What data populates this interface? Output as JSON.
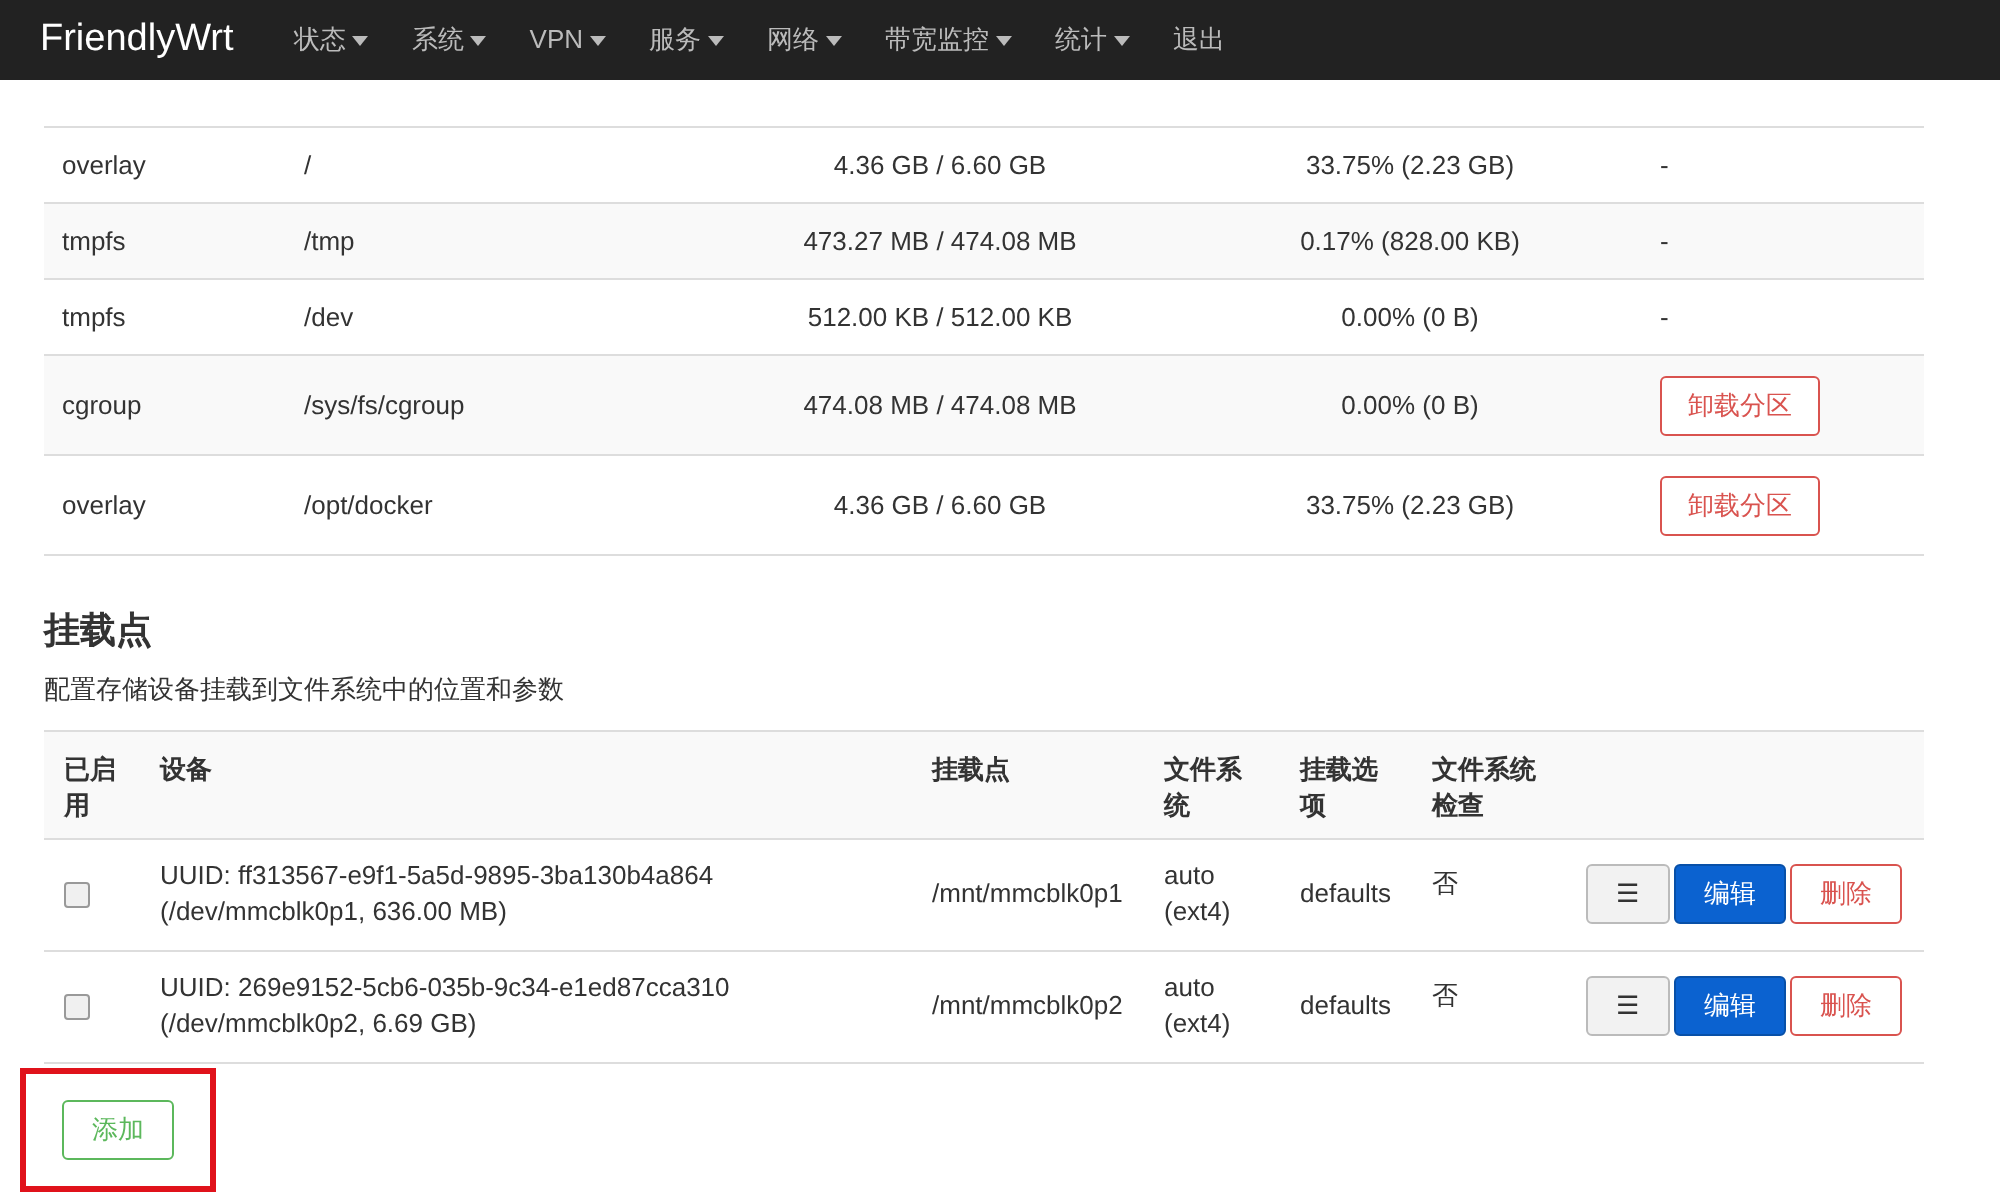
{
  "navbar": {
    "brand": "FriendlyWrt",
    "menu": [
      {
        "label": "状态",
        "dropdown": true
      },
      {
        "label": "系统",
        "dropdown": true
      },
      {
        "label": "VPN",
        "dropdown": true
      },
      {
        "label": "服务",
        "dropdown": true
      },
      {
        "label": "网络",
        "dropdown": true
      },
      {
        "label": "带宽监控",
        "dropdown": true
      },
      {
        "label": "统计",
        "dropdown": true
      },
      {
        "label": "退出",
        "dropdown": false
      }
    ]
  },
  "mounted_table": {
    "rows": [
      {
        "filesystem": "overlay",
        "mount": "/",
        "size": "4.36 GB / 6.60 GB",
        "usage": "33.75% (2.23 GB)",
        "action": "-"
      },
      {
        "filesystem": "tmpfs",
        "mount": "/tmp",
        "size": "473.27 MB / 474.08 MB",
        "usage": "0.17% (828.00 KB)",
        "action": "-"
      },
      {
        "filesystem": "tmpfs",
        "mount": "/dev",
        "size": "512.00 KB / 512.00 KB",
        "usage": "0.00% (0 B)",
        "action": "-"
      },
      {
        "filesystem": "cgroup",
        "mount": "/sys/fs/cgroup",
        "size": "474.08 MB / 474.08 MB",
        "usage": "0.00% (0 B)",
        "unmount_button": "卸载分区"
      },
      {
        "filesystem": "overlay",
        "mount": "/opt/docker",
        "size": "4.36 GB / 6.60 GB",
        "usage": "33.75% (2.23 GB)",
        "unmount_button": "卸载分区"
      }
    ]
  },
  "mount_points": {
    "title": "挂载点",
    "description": "配置存储设备挂载到文件系统中的位置和参数",
    "columns": [
      "已启用",
      "设备",
      "挂载点",
      "文件系统",
      "挂载选项",
      "文件系统检查"
    ],
    "rows": [
      {
        "enabled": false,
        "device": "UUID: ff313567-e9f1-5a5d-9895-3ba130b4a864",
        "device_detail": "(/dev/mmcblk0p1, 636.00 MB)",
        "mount_point": "/mnt/mmcblk0p1",
        "filesystem": "auto",
        "filesystem_detail": "(ext4)",
        "options": "defaults",
        "fsck": "否",
        "menu_button": "☰",
        "edit_button": "编辑",
        "delete_button": "删除"
      },
      {
        "enabled": false,
        "device": "UUID: 269e9152-5cb6-035b-9c34-e1ed87cca310",
        "device_detail": "(/dev/mmcblk0p2, 6.69 GB)",
        "mount_point": "/mnt/mmcblk0p2",
        "filesystem": "auto",
        "filesystem_detail": "(ext4)",
        "options": "defaults",
        "fsck": "否",
        "menu_button": "☰",
        "edit_button": "编辑",
        "delete_button": "删除"
      }
    ],
    "add_button": {
      "label": "添加",
      "highlighted": true
    }
  }
}
